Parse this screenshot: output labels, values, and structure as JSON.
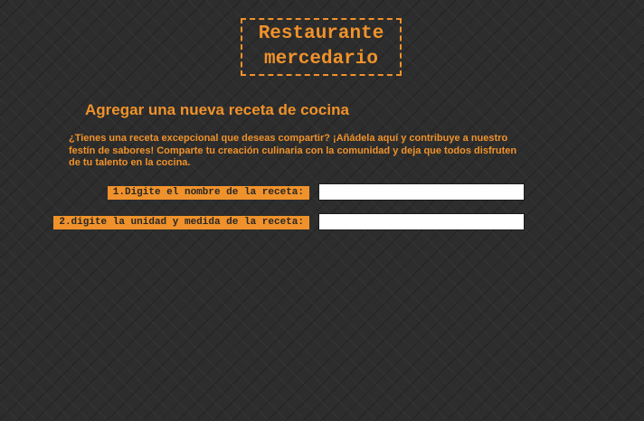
{
  "brand": {
    "logo_text": "Restaurante\nmercedario"
  },
  "page": {
    "title": "Agregar una nueva receta de cocina",
    "intro": "¿Tienes una receta excepcional que deseas compartir? ¡Añádela aquí y contribuye a nuestro festín de sabores! Comparte tu creación culinaria con la comunidad y deja que todos disfruten de tu talento en la cocina."
  },
  "form": {
    "recipe_name": {
      "label": "1.Digite el nombre de la receta:",
      "value": "",
      "placeholder": ""
    },
    "unit_measure": {
      "label": "2.digite la unidad y medida de la receta:",
      "value": "",
      "placeholder": ""
    }
  },
  "colors": {
    "accent": "#f0922b",
    "background": "#2d2d2d",
    "input_bg": "#ffffff"
  }
}
